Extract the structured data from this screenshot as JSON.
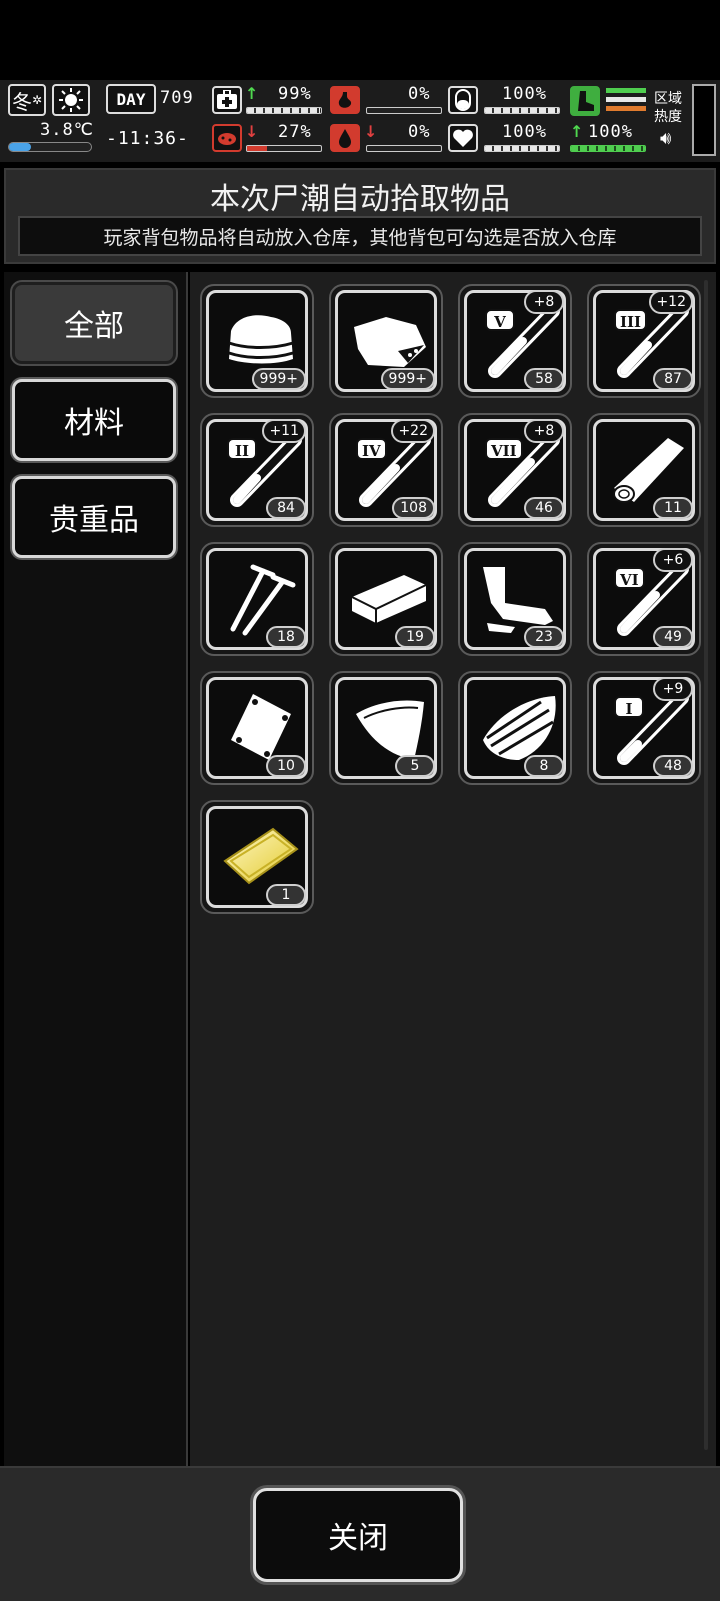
{
  "status": {
    "season": "冬",
    "temperature": "3.8℃",
    "day_label": "DAY",
    "day": "709",
    "time": "-11:36-",
    "health": "99%",
    "stomach": "0%",
    "stamina_top": "100%",
    "infection": "27%",
    "blood": "0%",
    "mood": "100%",
    "energy": "100%",
    "area_heat_label": "区域热度"
  },
  "header": {
    "title": "本次尸潮自动拾取物品",
    "subtitle": "玩家背包物品将自动放入仓库，其他背包可勾选是否放入仓库"
  },
  "sidebar": {
    "tabs": [
      {
        "label": "全部",
        "active": true
      },
      {
        "label": "材料",
        "active": false
      },
      {
        "label": "贵重品",
        "active": false
      }
    ]
  },
  "items": [
    {
      "name": "cloth-icon",
      "count": "999+",
      "rank": "",
      "bonus": ""
    },
    {
      "name": "meat-icon",
      "count": "999+",
      "rank": "",
      "bonus": ""
    },
    {
      "name": "test-tube-icon",
      "count": "58",
      "rank": "V",
      "bonus": "+8"
    },
    {
      "name": "test-tube-icon",
      "count": "87",
      "rank": "III",
      "bonus": "+12"
    },
    {
      "name": "test-tube-icon",
      "count": "84",
      "rank": "II",
      "bonus": "+11"
    },
    {
      "name": "test-tube-icon",
      "count": "108",
      "rank": "IV",
      "bonus": "+22"
    },
    {
      "name": "test-tube-icon",
      "count": "46",
      "rank": "VII",
      "bonus": "+8"
    },
    {
      "name": "log-icon",
      "count": "11",
      "rank": "",
      "bonus": ""
    },
    {
      "name": "nails-icon",
      "count": "18",
      "rank": "",
      "bonus": ""
    },
    {
      "name": "brick-icon",
      "count": "19",
      "rank": "",
      "bonus": ""
    },
    {
      "name": "pipe-icon",
      "count": "23",
      "rank": "",
      "bonus": ""
    },
    {
      "name": "test-tube-icon",
      "count": "49",
      "rank": "VI",
      "bonus": "+6"
    },
    {
      "name": "metal-plate-icon",
      "count": "10",
      "rank": "",
      "bonus": ""
    },
    {
      "name": "glass-sheet-icon",
      "count": "5",
      "rank": "",
      "bonus": ""
    },
    {
      "name": "wood-planks-icon",
      "count": "8",
      "rank": "",
      "bonus": ""
    },
    {
      "name": "test-tube-icon",
      "count": "48",
      "rank": "I",
      "bonus": "+9"
    },
    {
      "name": "gold-bar-icon",
      "count": "1",
      "rank": "",
      "bonus": ""
    }
  ],
  "footer": {
    "close_label": "关闭"
  }
}
